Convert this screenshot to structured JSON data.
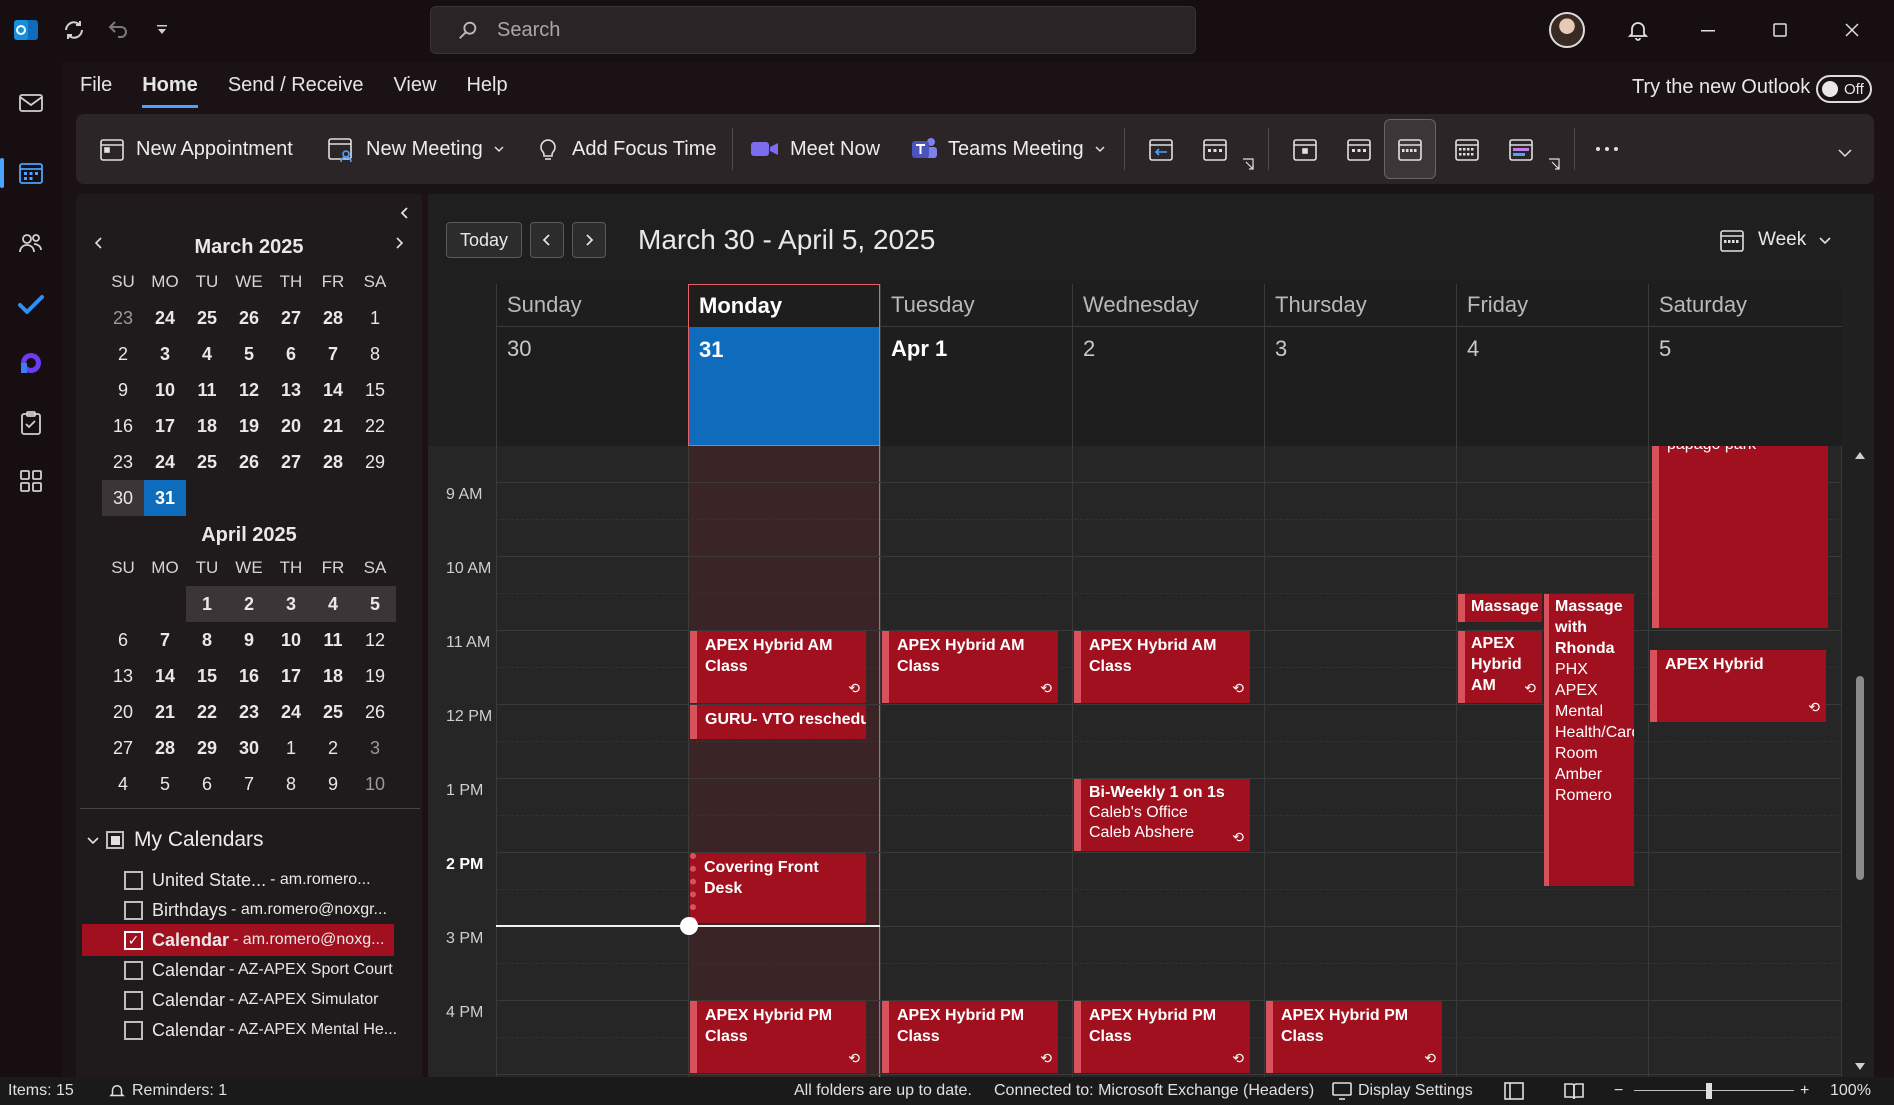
{
  "app": {
    "search_placeholder": "Search"
  },
  "menu": {
    "tabs": [
      "File",
      "Home",
      "Send / Receive",
      "View",
      "Help"
    ],
    "active_tab": "Home",
    "try_new": "Try the new Outlook",
    "toggle_state": "Off"
  },
  "ribbon": {
    "new_appointment": "New Appointment",
    "new_meeting": "New Meeting",
    "add_focus_time": "Add Focus Time",
    "meet_now": "Meet Now",
    "teams_meeting": "Teams Meeting"
  },
  "minical": {
    "weekday_headers": [
      "SU",
      "MO",
      "TU",
      "WE",
      "TH",
      "FR",
      "SA"
    ],
    "march": {
      "title": "March 2025",
      "weeks": [
        [
          "23",
          "24",
          "25",
          "26",
          "27",
          "28",
          "1"
        ],
        [
          "2",
          "3",
          "4",
          "5",
          "6",
          "7",
          "8"
        ],
        [
          "9",
          "10",
          "11",
          "12",
          "13",
          "14",
          "15"
        ],
        [
          "16",
          "17",
          "18",
          "19",
          "20",
          "21",
          "22"
        ],
        [
          "23",
          "24",
          "25",
          "26",
          "27",
          "28",
          "29"
        ],
        [
          "30",
          "31",
          "",
          "",
          "",
          "",
          ""
        ]
      ]
    },
    "april": {
      "title": "April 2025",
      "weeks": [
        [
          "",
          "",
          "1",
          "2",
          "3",
          "4",
          "5"
        ],
        [
          "6",
          "7",
          "8",
          "9",
          "10",
          "11",
          "12"
        ],
        [
          "13",
          "14",
          "15",
          "16",
          "17",
          "18",
          "19"
        ],
        [
          "20",
          "21",
          "22",
          "23",
          "24",
          "25",
          "26"
        ],
        [
          "27",
          "28",
          "29",
          "30",
          "1",
          "2",
          "3"
        ],
        [
          "4",
          "5",
          "6",
          "7",
          "8",
          "9",
          "10"
        ]
      ]
    }
  },
  "calendars": {
    "group_title": "My Calendars",
    "items": [
      {
        "name": "United State...",
        "account": "- am.romero...",
        "checked": false
      },
      {
        "name": "Birthdays",
        "account": "- am.romero@noxgr...",
        "checked": false
      },
      {
        "name": "Calendar",
        "account": "- am.romero@noxg...",
        "checked": true
      },
      {
        "name": "Calendar",
        "account": "- AZ-APEX Sport Court",
        "checked": false
      },
      {
        "name": "Calendar",
        "account": "- AZ-APEX Simulator",
        "checked": false
      },
      {
        "name": "Calendar",
        "account": "- AZ-APEX Mental He...",
        "checked": false
      }
    ]
  },
  "calendar_view": {
    "today_button": "Today",
    "date_range": "March 30 - April 5, 2025",
    "view_mode": "Week",
    "days": [
      {
        "name": "Sunday",
        "date": "30"
      },
      {
        "name": "Monday",
        "date": "31"
      },
      {
        "name": "Tuesday",
        "date": "Apr 1"
      },
      {
        "name": "Wednesday",
        "date": "2"
      },
      {
        "name": "Thursday",
        "date": "3"
      },
      {
        "name": "Friday",
        "date": "4"
      },
      {
        "name": "Saturday",
        "date": "5"
      }
    ],
    "hours": [
      "9 AM",
      "10 AM",
      "11 AM",
      "12 PM",
      "1 PM",
      "2 PM",
      "3 PM",
      "4 PM"
    ],
    "events": {
      "sat_partial": "papago park",
      "thu_massage": "Massage",
      "thu_massage_rhonda": "Massage with Rhonda",
      "thu_massage_rhonda_detail": "PHX APEX Mental Health/Card Room Amber Romero",
      "mon_hybrid_am": "APEX Hybrid AM Class",
      "tue_hybrid_am": "APEX Hybrid AM Class",
      "wed_hybrid_am": "APEX Hybrid AM Class",
      "thu_hybrid_am": "APEX Hybrid AM",
      "fri_hybrid": "APEX Hybrid",
      "mon_guru": "GURU- VTO reschedu",
      "wed_biweekly": "Bi-Weekly 1 on 1s",
      "wed_biweekly_loc": "Caleb's Office",
      "wed_biweekly_org": "Caleb Abshere",
      "mon_covering": "Covering Front Desk",
      "mon_hybrid_pm": "APEX Hybrid PM Class",
      "tue_hybrid_pm": "APEX Hybrid PM Class",
      "wed_hybrid_pm": "APEX Hybrid PM Class",
      "thu_hybrid_pm": "APEX Hybrid PM Class"
    }
  },
  "status": {
    "items": "Items: 15",
    "reminders": "Reminders: 1",
    "folders": "All folders are up to date.",
    "connection": "Connected to: Microsoft Exchange (Headers)",
    "display_settings": "Display Settings",
    "zoom": "100%"
  }
}
